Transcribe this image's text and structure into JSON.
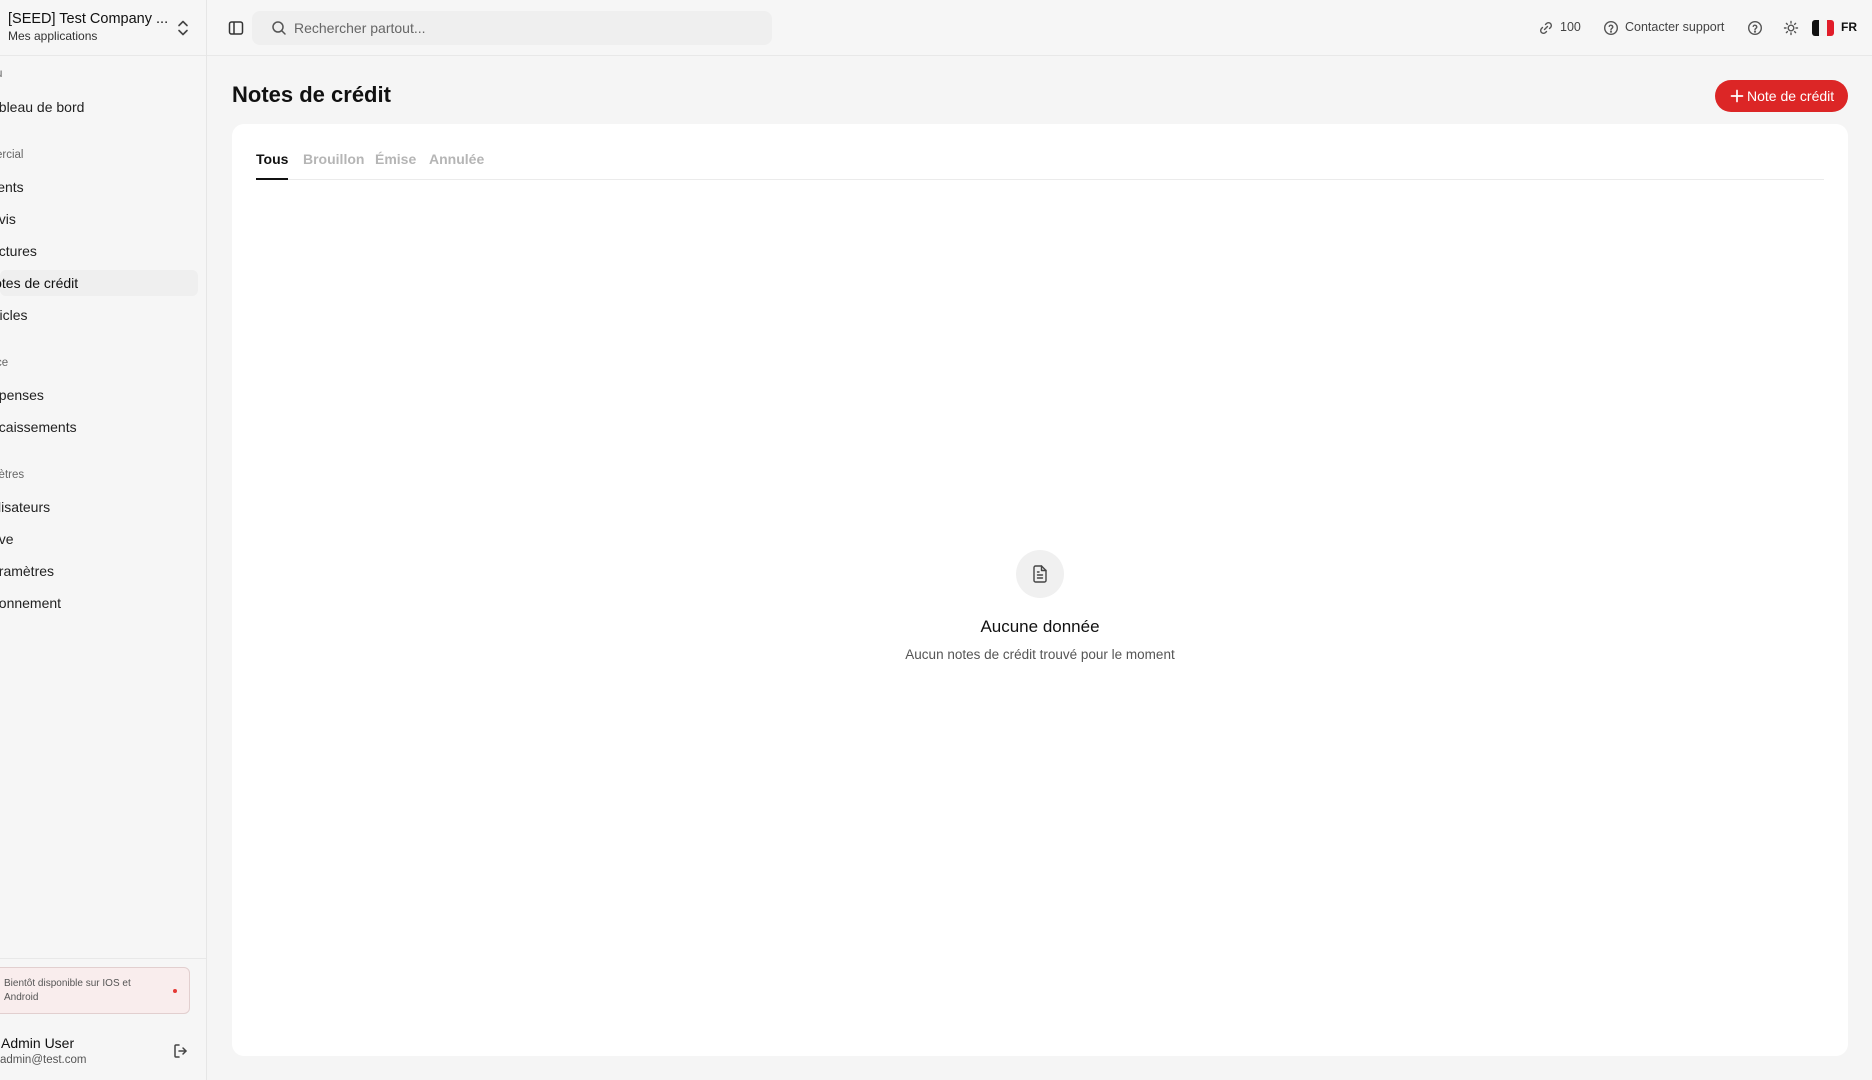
{
  "company": {
    "name": "[SEED] Test Company ...",
    "subtitle": "Mes applications"
  },
  "sidebar": {
    "groups": [
      {
        "label": "u",
        "items": [
          {
            "label": "ableau de bord"
          }
        ]
      },
      {
        "label": "ercial",
        "items": [
          {
            "label": "lients"
          },
          {
            "label": "evis"
          },
          {
            "label": "actures"
          },
          {
            "label": "lotes de crédit",
            "active": true
          },
          {
            "label": "rticles"
          }
        ]
      },
      {
        "label": "ce",
        "items": [
          {
            "label": "épenses"
          },
          {
            "label": "ncaissements"
          }
        ]
      },
      {
        "label": "iètres",
        "items": [
          {
            "label": "tilisateurs"
          },
          {
            "label": "rive"
          },
          {
            "label": "aramètres"
          },
          {
            "label": "bonnement"
          }
        ]
      }
    ],
    "promo": "Bientôt disponible sur IOS et Android",
    "user": {
      "name": "Admin User",
      "email": "admin@test.com"
    }
  },
  "topbar": {
    "search_placeholder": "Rechercher partout...",
    "credits": "100",
    "support": "Contacter support",
    "lang": "FR"
  },
  "main": {
    "title": "Notes de crédit",
    "new_button": "Note de crédit",
    "tabs": [
      {
        "label": "Tous",
        "active": true
      },
      {
        "label": "Brouillon"
      },
      {
        "label": "Émise"
      },
      {
        "label": "Annulée"
      }
    ],
    "empty": {
      "title": "Aucune donnée",
      "description": "Aucun notes de crédit trouvé pour le moment"
    }
  },
  "colors": {
    "accent": "#dc2626",
    "active_tab": "#111111"
  },
  "icons": [
    "chevron-updown-icon",
    "sidebar-toggle-icon",
    "search-icon",
    "link-icon",
    "help-circle-icon",
    "sun-icon",
    "flag-fr-icon",
    "plus-icon",
    "file-text-icon",
    "logout-icon"
  ]
}
